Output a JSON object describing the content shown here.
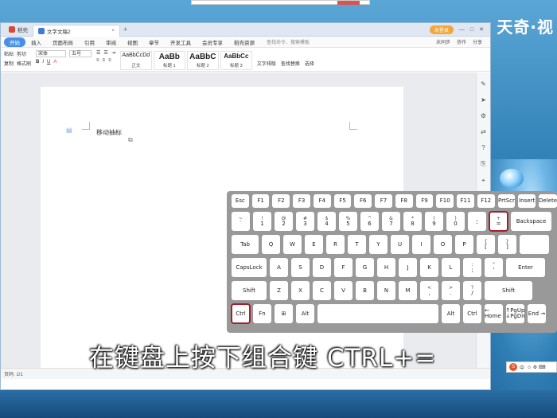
{
  "window": {
    "tabs": [
      {
        "label": "稻壳"
      },
      {
        "label": "文字文稿2"
      }
    ],
    "login_label": "未登录",
    "menu": [
      "开始",
      "插入",
      "页面布局",
      "引用",
      "审阅",
      "视图",
      "章节",
      "开发工具",
      "会员专享",
      "稻壳资源"
    ],
    "search_placeholder": "查找命令、搜索模板",
    "menu_right": [
      "未同步",
      "协作",
      "分享"
    ]
  },
  "ribbon": {
    "font_name": "宋体",
    "font_size": "五号",
    "paste_label": "粘贴",
    "cut_label": "剪切",
    "copy_label": "复制",
    "format_label": "格式刷",
    "styles": [
      {
        "preview": "AaBbCcDd",
        "name": "正文"
      },
      {
        "preview": "AaBb",
        "name": "标题 1"
      },
      {
        "preview": "AaBbC",
        "name": "标题 2"
      },
      {
        "preview": "AaBbCc",
        "name": "标题 3"
      }
    ],
    "text_tools_label": "文字排版",
    "find_replace_label": "查找替换",
    "select_label": "选择"
  },
  "document": {
    "text": "移动抽标"
  },
  "statusbar": {
    "page": "页码: 1/1"
  },
  "keyboard": {
    "rows": [
      [
        "Esc",
        "F1",
        "F2",
        "F3",
        "F4",
        "F5",
        "F6",
        "F7",
        "F8",
        "F9",
        "F10",
        "F11",
        "F12",
        "PrtScr",
        "Insert",
        "Delete"
      ],
      [
        "~|`",
        "!|1",
        "@|2",
        "#|3",
        "$|4",
        "%|5",
        "^|6",
        "&|7",
        "*|8",
        "(|9",
        ")|0",
        "_|-",
        "+|=",
        "Backspace"
      ],
      [
        "Tab",
        "Q",
        "W",
        "E",
        "R",
        "T",
        "Y",
        "U",
        "I",
        "O",
        "P",
        "{|[",
        "}|]",
        "||\\"
      ],
      [
        "CapsLock",
        "A",
        "S",
        "D",
        "F",
        "G",
        "H",
        "J",
        "K",
        "L",
        ":|;",
        "\"|'",
        "Enter"
      ],
      [
        "Shift",
        "Z",
        "X",
        "C",
        "V",
        "B",
        "N",
        "M",
        "<|,",
        ">|.",
        "?|/",
        "Shift"
      ],
      [
        "Ctrl",
        "Fn",
        "⊞",
        "Alt",
        "",
        "Alt",
        "Ctrl",
        "← Home",
        "↑PgUp ↓PgDn",
        "End →"
      ]
    ]
  },
  "subtitle": "在键盘上按下组合键 CTRL+=",
  "watermark": "天奇·视",
  "tray": {
    "ime": "中"
  },
  "colors": {
    "highlight": "#a31f2c",
    "keyboard_bg": "#999999",
    "accent": "#4a8fe7"
  }
}
